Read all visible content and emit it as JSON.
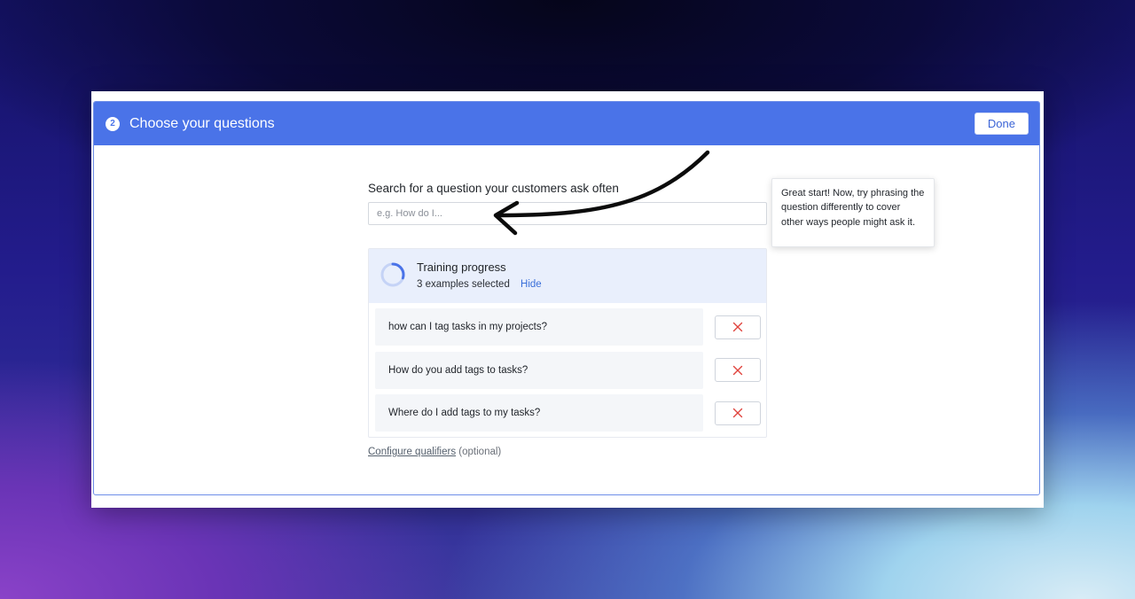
{
  "header": {
    "step_number": "2",
    "title": "Choose your questions",
    "done_label": "Done"
  },
  "search": {
    "label": "Search for a question your customers ask often",
    "placeholder": "e.g. How do I...",
    "value": ""
  },
  "progress": {
    "title": "Training progress",
    "count_text": "3 examples selected",
    "hide_label": "Hide",
    "progress_fraction": 0.3
  },
  "examples": [
    {
      "text": "how can I tag tasks in my projects?"
    },
    {
      "text": "How do you add tags to tasks?"
    },
    {
      "text": "Where do I add tags to my tasks?"
    }
  ],
  "configure": {
    "link_label": "Configure qualifiers",
    "suffix": "(optional)"
  },
  "tooltip": {
    "text": "Great start! Now, try phrasing the question differently to cover other ways people might ask it."
  },
  "colors": {
    "accent": "#4a73e8",
    "remove_icon": "#e0443e",
    "progress_bg": "#e9effc",
    "link": "#3a6fd9"
  },
  "icons": {
    "step": "step-number-badge",
    "progress": "progress-ring-icon",
    "remove": "close-x-icon",
    "annotation": "hand-drawn-arrow"
  }
}
